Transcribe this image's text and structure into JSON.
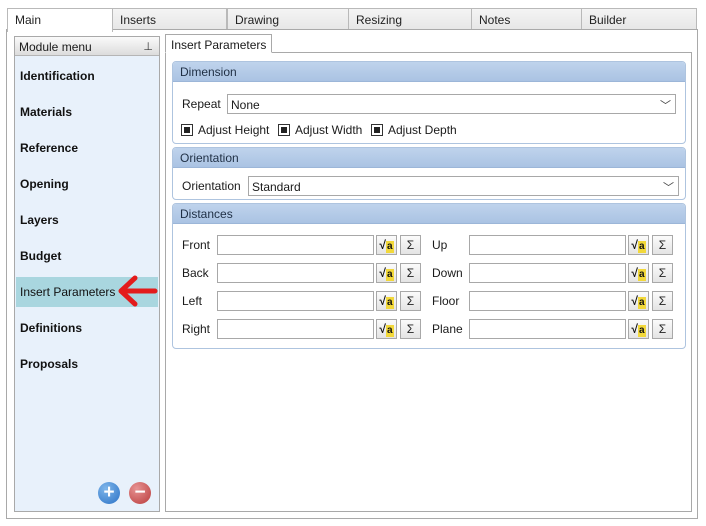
{
  "top_tabs": [
    {
      "label": "Main"
    },
    {
      "label": "Inserts"
    },
    {
      "label": "Drawing"
    },
    {
      "label": "Resizing"
    },
    {
      "label": "Notes"
    },
    {
      "label": "Builder"
    }
  ],
  "module_menu": {
    "title": "Module menu",
    "items": [
      {
        "label": "Identification"
      },
      {
        "label": "Materials"
      },
      {
        "label": "Reference"
      },
      {
        "label": "Opening"
      },
      {
        "label": "Layers"
      },
      {
        "label": "Budget"
      },
      {
        "label": "Insert Parameters"
      },
      {
        "label": "Definitions"
      },
      {
        "label": "Proposals"
      }
    ]
  },
  "content_tab": "Insert Parameters",
  "dimension": {
    "header": "Dimension",
    "repeat_label": "Repeat",
    "repeat_value": "None",
    "checkboxes": [
      {
        "label": "Adjust Height",
        "checked": true
      },
      {
        "label": "Adjust Width",
        "checked": true
      },
      {
        "label": "Adjust Depth",
        "checked": true
      }
    ]
  },
  "orientation": {
    "header": "Orientation",
    "label": "Orientation",
    "value": "Standard"
  },
  "distances": {
    "header": "Distances",
    "left_fields": [
      {
        "label": "Front",
        "value": ""
      },
      {
        "label": "Back",
        "value": ""
      },
      {
        "label": "Left",
        "value": ""
      },
      {
        "label": "Right",
        "value": ""
      }
    ],
    "right_fields": [
      {
        "label": "Up",
        "value": ""
      },
      {
        "label": "Down",
        "value": ""
      },
      {
        "label": "Floor",
        "value": ""
      },
      {
        "label": "Plane",
        "value": ""
      }
    ],
    "formula_glyph": "√",
    "formula_badge": "a",
    "sigma_glyph": "Σ"
  },
  "icons": {
    "pin": "pin-icon",
    "add": "add-icon",
    "remove": "remove-icon",
    "arrow": "red-arrow-pointer",
    "add_glyph": "+",
    "remove_glyph": "−",
    "pin_glyph": "⊥",
    "chevron_glyph": "﹀"
  },
  "colors": {
    "selected_item": "#a9d6df",
    "group_header": "#aac3e3",
    "arrow": "#e31b1b"
  }
}
